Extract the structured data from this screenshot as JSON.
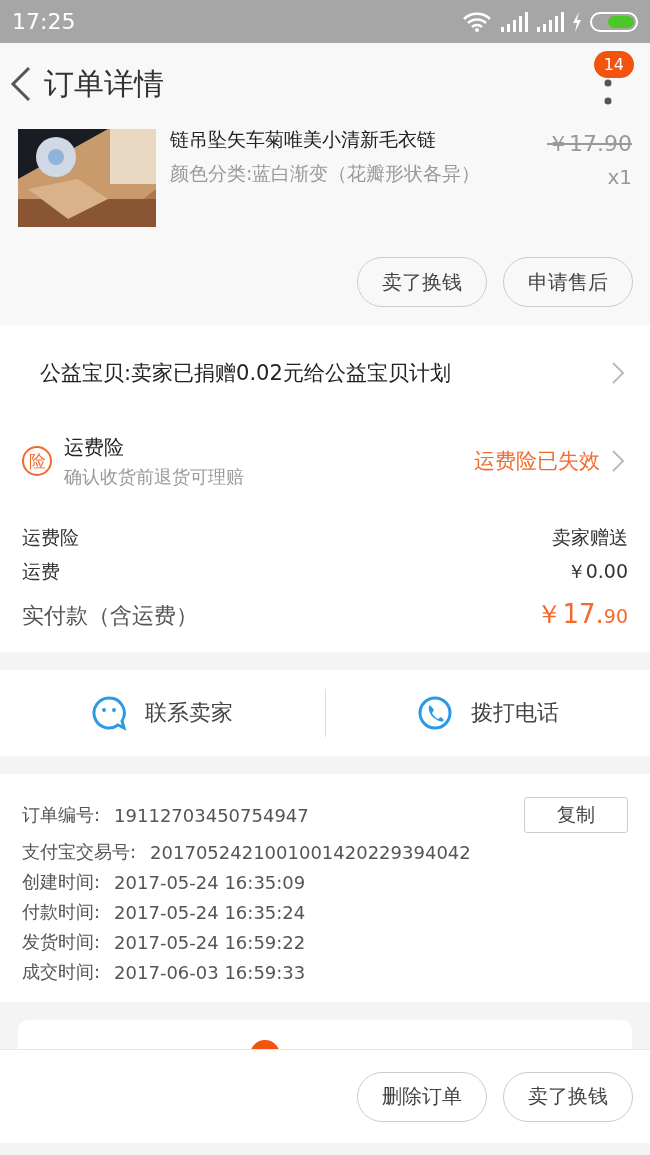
{
  "status_bar": {
    "time": "17:25"
  },
  "header": {
    "title": "订单详情",
    "badge": "14"
  },
  "product": {
    "kind": "picture",
    "title": "链吊坠矢车菊唯美小清新毛衣链",
    "variant": "颜色分类:蓝白渐变（花瓣形状各异）",
    "original_price": "￥17.90",
    "quantity": "x1"
  },
  "item_actions": [
    "卖了换钱",
    "申请售后"
  ],
  "charity": {
    "text": "公益宝贝:卖家已捐赠0.02元给公益宝贝计划"
  },
  "insurance": {
    "icon": "险",
    "title": "运费险",
    "subtitle": "确认收货前退货可理赔",
    "status": "运费险已失效"
  },
  "fees": [
    {
      "label": "运费险",
      "value": "卖家赠送"
    },
    {
      "label": "运费",
      "value": "￥0.00"
    }
  ],
  "total": {
    "label": "实付款（含运费）",
    "currency": "￥",
    "integer": "17.",
    "decimal": "90"
  },
  "contact": [
    {
      "kind": "chat",
      "label": "联系卖家"
    },
    {
      "kind": "phone",
      "label": "拨打电话"
    }
  ],
  "order_info": {
    "copy_button": "复制",
    "rows": [
      {
        "label": "订单编号:",
        "value": "19112703450754947"
      },
      {
        "label": "支付宝交易号:",
        "value": "2017052421001001420229394042"
      },
      {
        "label": "创建时间:",
        "value": "2017-05-24 16:35:09"
      },
      {
        "label": "付款时间:",
        "value": "2017-05-24 16:35:24"
      },
      {
        "label": "发货时间:",
        "value": "2017-05-24 16:59:22"
      },
      {
        "label": "成交时间:",
        "value": "2017-06-03 16:59:33"
      }
    ]
  },
  "bottom_actions": [
    "删除订单",
    "卖了换钱"
  ]
}
